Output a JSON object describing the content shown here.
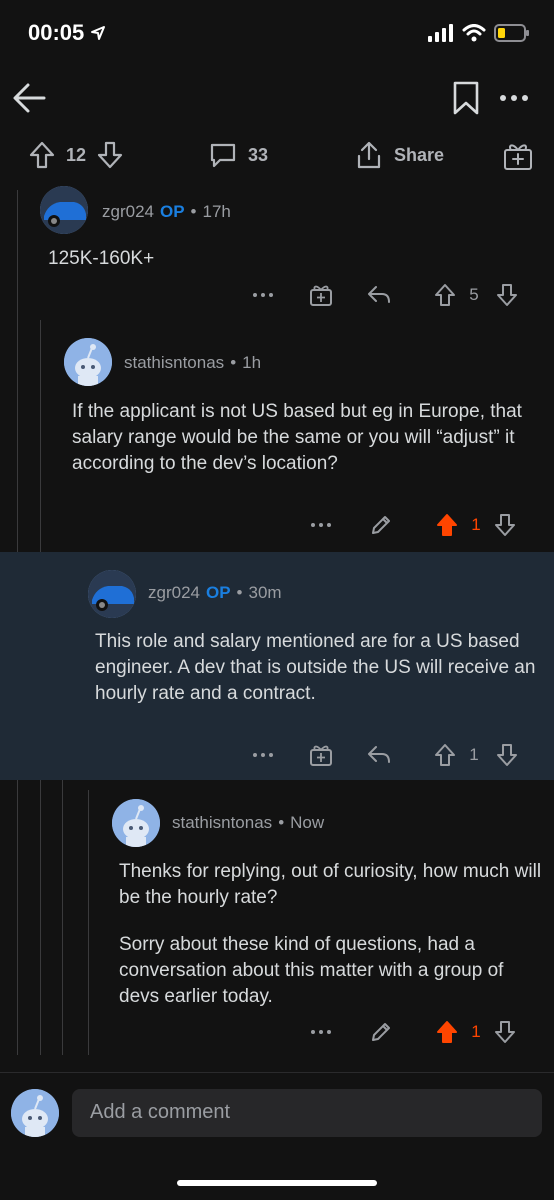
{
  "status_bar": {
    "time": "00:05"
  },
  "post_actions": {
    "upvotes": "12",
    "comments": "33",
    "share_label": "Share"
  },
  "comments": [
    {
      "author": "zgr024",
      "op_badge": "OP",
      "age": "17h",
      "body": "125K-160K+",
      "score": "5"
    },
    {
      "author": "stathisntonas",
      "age": "1h",
      "body": "If the applicant is not US based but eg in Europe, that salary range would be the same or you will “adjust” it according to the dev’s location?",
      "score": "1"
    },
    {
      "author": "zgr024",
      "op_badge": "OP",
      "age": "30m",
      "body": "This role and salary mentioned are for a US based engineer. A dev that is outside the US will receive an hourly rate and a contract.",
      "score": "1"
    },
    {
      "author": "stathisntonas",
      "age": "Now",
      "body_p1": "Thenks for replying, out of curiosity, how much will be the hourly rate?",
      "body_p2": "Sorry about these kind of questions, had a conversation about this matter with a group of devs earlier today.",
      "score": "1"
    }
  ],
  "composer": {
    "placeholder": "Add a comment"
  },
  "colors": {
    "background": "#121212",
    "op": "#1a7fe0",
    "upvoted": "#ff4500",
    "highlight": "#1f2a36"
  }
}
